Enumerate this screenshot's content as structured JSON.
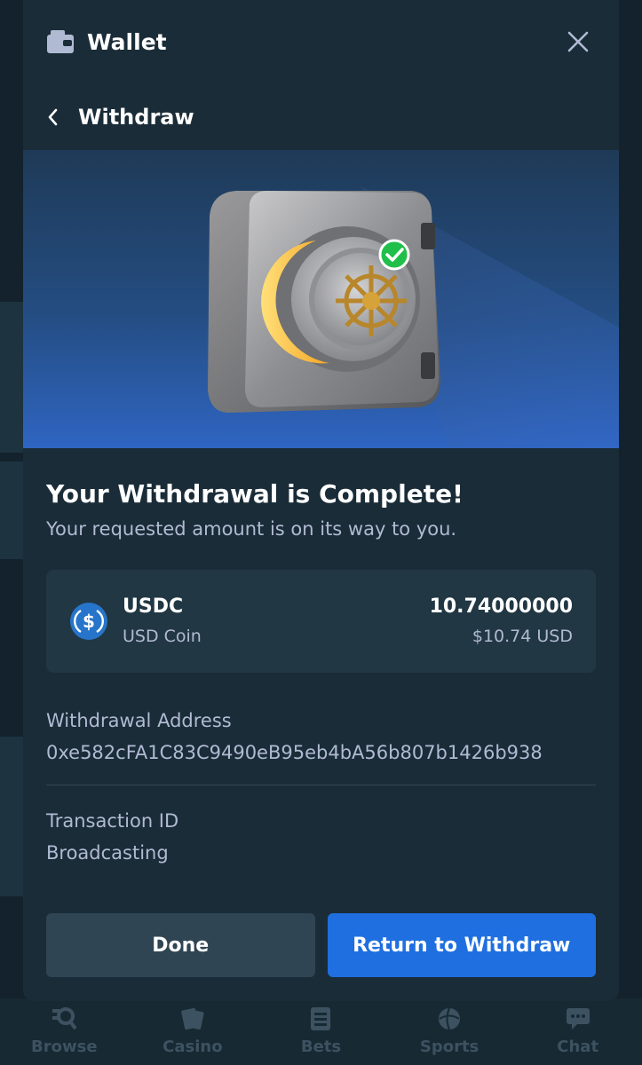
{
  "header": {
    "title": "Wallet"
  },
  "subheader": {
    "title": "Withdraw"
  },
  "status": {
    "title": "Your Withdrawal is Complete!",
    "subtitle": "Your requested amount is on its way to you."
  },
  "coin": {
    "symbol": "USDC",
    "name": "USD Coin",
    "amount": "10.74000000",
    "usd_value": "$10.74 USD"
  },
  "withdrawal_address": {
    "label": "Withdrawal Address",
    "value": "0xe582cFA1C83C9490eB95eb4bA56b807b1426b938"
  },
  "transaction": {
    "label": "Transaction ID",
    "value": "Broadcasting"
  },
  "buttons": {
    "done": "Done",
    "return": "Return to Withdraw"
  },
  "bottom_nav": [
    {
      "label": "Browse",
      "icon": "search-icon"
    },
    {
      "label": "Casino",
      "icon": "cards-icon"
    },
    {
      "label": "Bets",
      "icon": "bets-icon"
    },
    {
      "label": "Sports",
      "icon": "ball-icon"
    },
    {
      "label": "Chat",
      "icon": "chat-icon"
    }
  ],
  "colors": {
    "modal_bg": "#1a2c38",
    "card_bg": "#213743",
    "accent_blue": "#1f6fe0",
    "muted_text": "#b1bad3",
    "success_green": "#1fbf4a",
    "usdc_blue": "#2775ca"
  }
}
